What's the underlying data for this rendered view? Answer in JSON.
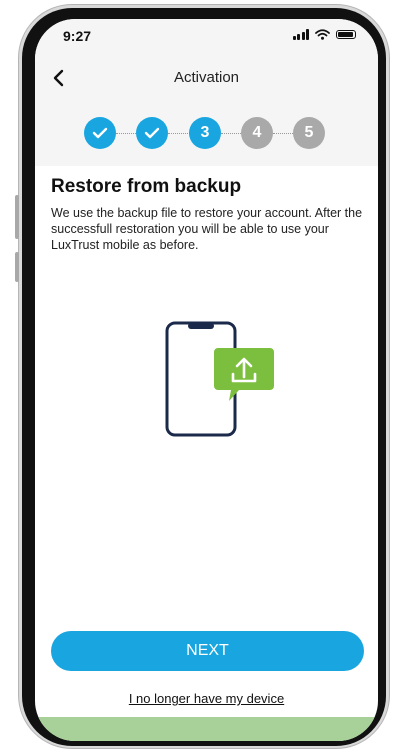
{
  "status_bar": {
    "time": "9:27"
  },
  "header": {
    "title": "Activation"
  },
  "stepper": {
    "steps": [
      {
        "label": "",
        "state": "done"
      },
      {
        "label": "",
        "state": "done"
      },
      {
        "label": "3",
        "state": "current"
      },
      {
        "label": "4",
        "state": "todo"
      },
      {
        "label": "5",
        "state": "todo"
      }
    ]
  },
  "content": {
    "title": "Restore from backup",
    "description": "We use the backup file to restore your account. After the successfull restoration you will be able to use your LuxTrust mobile as before."
  },
  "actions": {
    "next_label": "NEXT",
    "no_device_label": "I no longer have my device"
  },
  "colors": {
    "accent": "#19a6e0",
    "inactive_step": "#a9a9a9",
    "upload_badge": "#7cbf3f",
    "phone_outline": "#1b2a4a"
  },
  "icons": [
    "back-chevron-icon",
    "checkmark-icon",
    "signal-icon",
    "wifi-icon",
    "battery-icon",
    "phone-illustration",
    "upload-icon"
  ]
}
